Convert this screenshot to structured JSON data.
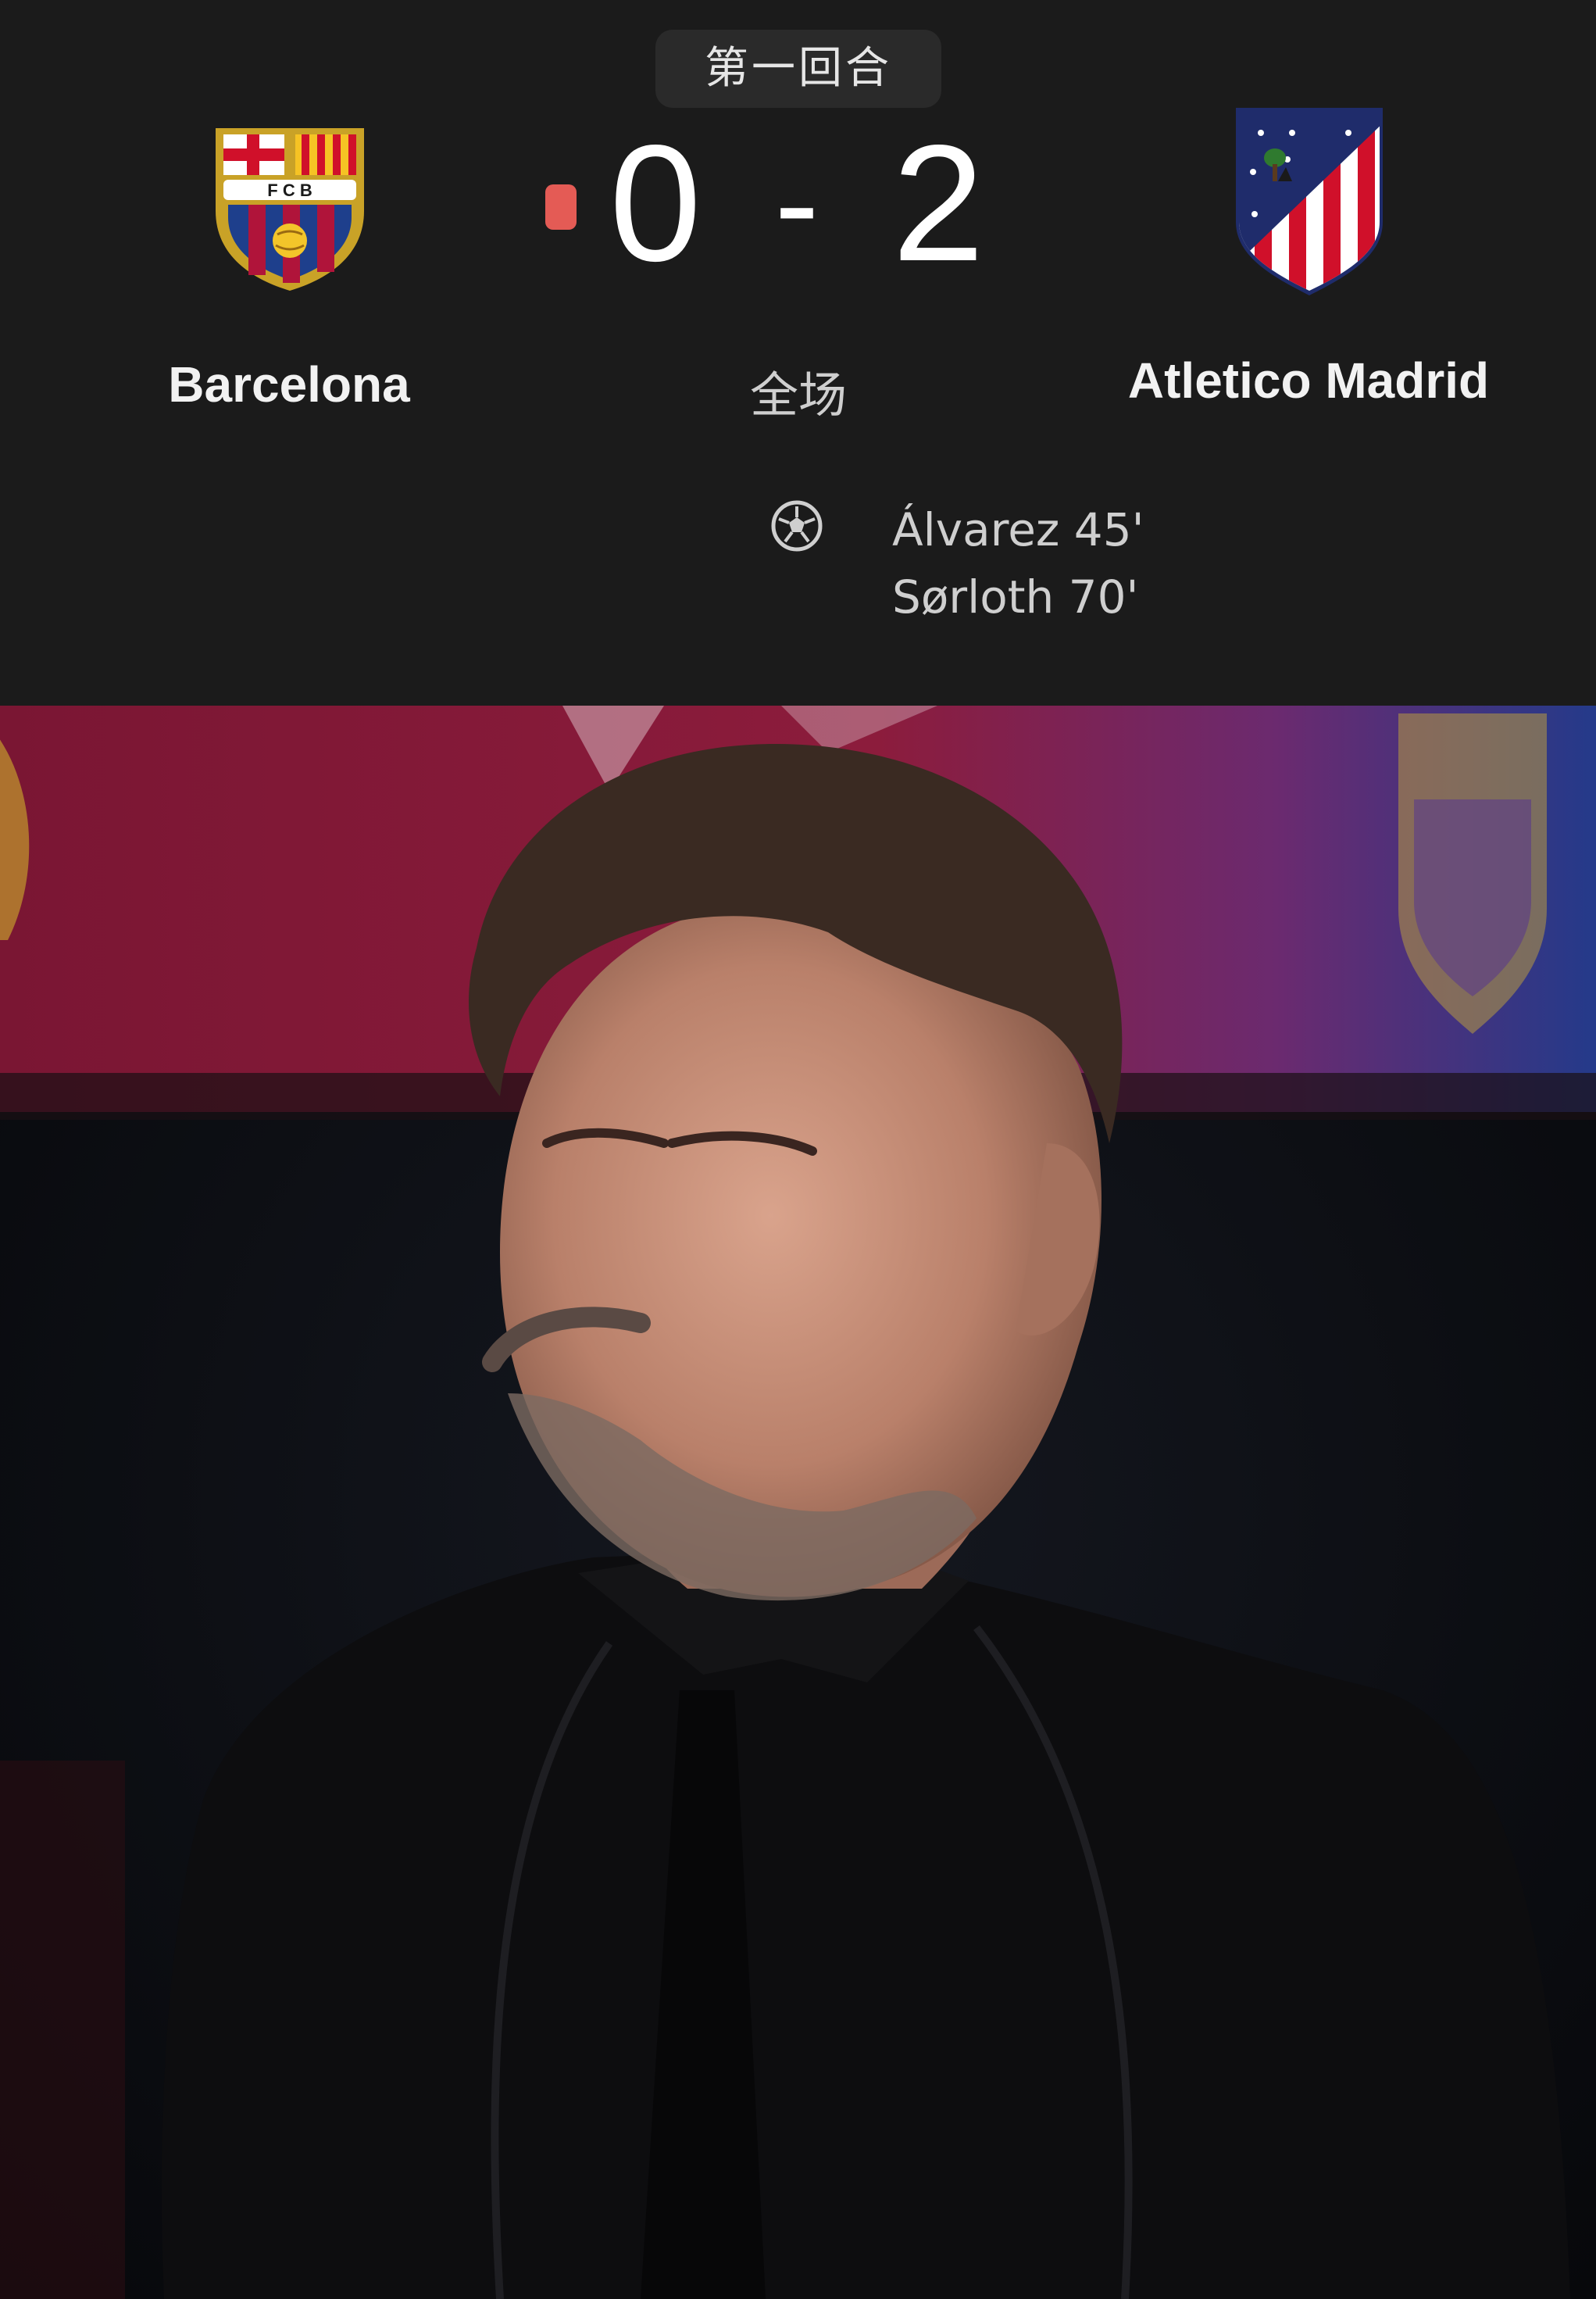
{
  "match": {
    "round_label": "第一回合",
    "status_label": "全场",
    "home_team": {
      "name": "Barcelona",
      "crest_icon": "barcelona-crest-icon"
    },
    "away_team": {
      "name": "Atletico Madrid",
      "crest_icon": "atletico-madrid-crest-icon"
    },
    "score": {
      "home": "0",
      "separator": "-",
      "away": "2"
    },
    "live_indicator_color": "#e45b55",
    "goal_icon": "soccer-ball-icon",
    "scorers": [
      {
        "text": "Álvarez 45'"
      },
      {
        "text": "Sørloth 70'"
      }
    ]
  },
  "photo": {
    "subject": "coach-portrait-photo"
  }
}
